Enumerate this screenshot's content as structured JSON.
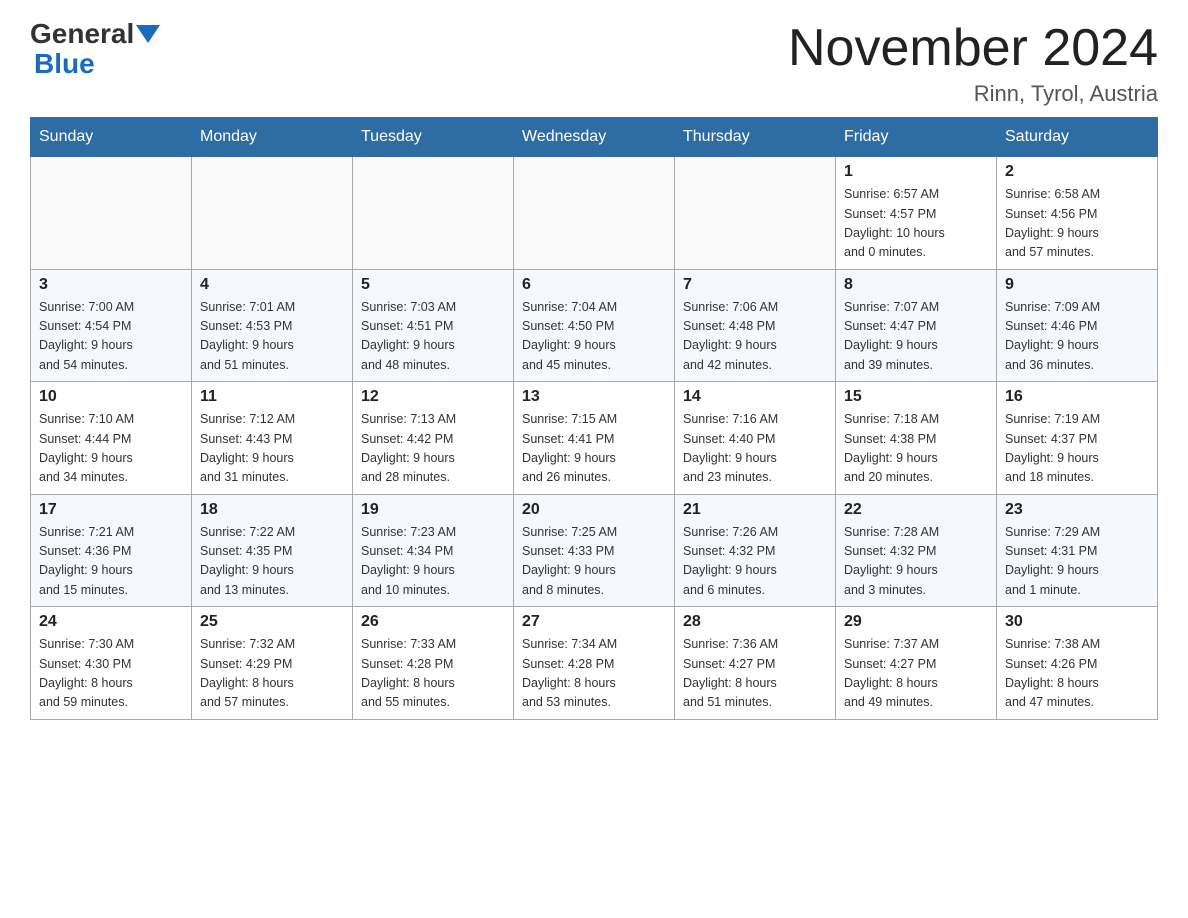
{
  "header": {
    "logo_line1": "General",
    "logo_line2": "Blue",
    "month_title": "November 2024",
    "location": "Rinn, Tyrol, Austria"
  },
  "weekdays": [
    "Sunday",
    "Monday",
    "Tuesday",
    "Wednesday",
    "Thursday",
    "Friday",
    "Saturday"
  ],
  "rows": [
    {
      "days": [
        {
          "number": "",
          "info": ""
        },
        {
          "number": "",
          "info": ""
        },
        {
          "number": "",
          "info": ""
        },
        {
          "number": "",
          "info": ""
        },
        {
          "number": "",
          "info": ""
        },
        {
          "number": "1",
          "info": "Sunrise: 6:57 AM\nSunset: 4:57 PM\nDaylight: 10 hours\nand 0 minutes."
        },
        {
          "number": "2",
          "info": "Sunrise: 6:58 AM\nSunset: 4:56 PM\nDaylight: 9 hours\nand 57 minutes."
        }
      ]
    },
    {
      "days": [
        {
          "number": "3",
          "info": "Sunrise: 7:00 AM\nSunset: 4:54 PM\nDaylight: 9 hours\nand 54 minutes."
        },
        {
          "number": "4",
          "info": "Sunrise: 7:01 AM\nSunset: 4:53 PM\nDaylight: 9 hours\nand 51 minutes."
        },
        {
          "number": "5",
          "info": "Sunrise: 7:03 AM\nSunset: 4:51 PM\nDaylight: 9 hours\nand 48 minutes."
        },
        {
          "number": "6",
          "info": "Sunrise: 7:04 AM\nSunset: 4:50 PM\nDaylight: 9 hours\nand 45 minutes."
        },
        {
          "number": "7",
          "info": "Sunrise: 7:06 AM\nSunset: 4:48 PM\nDaylight: 9 hours\nand 42 minutes."
        },
        {
          "number": "8",
          "info": "Sunrise: 7:07 AM\nSunset: 4:47 PM\nDaylight: 9 hours\nand 39 minutes."
        },
        {
          "number": "9",
          "info": "Sunrise: 7:09 AM\nSunset: 4:46 PM\nDaylight: 9 hours\nand 36 minutes."
        }
      ]
    },
    {
      "days": [
        {
          "number": "10",
          "info": "Sunrise: 7:10 AM\nSunset: 4:44 PM\nDaylight: 9 hours\nand 34 minutes."
        },
        {
          "number": "11",
          "info": "Sunrise: 7:12 AM\nSunset: 4:43 PM\nDaylight: 9 hours\nand 31 minutes."
        },
        {
          "number": "12",
          "info": "Sunrise: 7:13 AM\nSunset: 4:42 PM\nDaylight: 9 hours\nand 28 minutes."
        },
        {
          "number": "13",
          "info": "Sunrise: 7:15 AM\nSunset: 4:41 PM\nDaylight: 9 hours\nand 26 minutes."
        },
        {
          "number": "14",
          "info": "Sunrise: 7:16 AM\nSunset: 4:40 PM\nDaylight: 9 hours\nand 23 minutes."
        },
        {
          "number": "15",
          "info": "Sunrise: 7:18 AM\nSunset: 4:38 PM\nDaylight: 9 hours\nand 20 minutes."
        },
        {
          "number": "16",
          "info": "Sunrise: 7:19 AM\nSunset: 4:37 PM\nDaylight: 9 hours\nand 18 minutes."
        }
      ]
    },
    {
      "days": [
        {
          "number": "17",
          "info": "Sunrise: 7:21 AM\nSunset: 4:36 PM\nDaylight: 9 hours\nand 15 minutes."
        },
        {
          "number": "18",
          "info": "Sunrise: 7:22 AM\nSunset: 4:35 PM\nDaylight: 9 hours\nand 13 minutes."
        },
        {
          "number": "19",
          "info": "Sunrise: 7:23 AM\nSunset: 4:34 PM\nDaylight: 9 hours\nand 10 minutes."
        },
        {
          "number": "20",
          "info": "Sunrise: 7:25 AM\nSunset: 4:33 PM\nDaylight: 9 hours\nand 8 minutes."
        },
        {
          "number": "21",
          "info": "Sunrise: 7:26 AM\nSunset: 4:32 PM\nDaylight: 9 hours\nand 6 minutes."
        },
        {
          "number": "22",
          "info": "Sunrise: 7:28 AM\nSunset: 4:32 PM\nDaylight: 9 hours\nand 3 minutes."
        },
        {
          "number": "23",
          "info": "Sunrise: 7:29 AM\nSunset: 4:31 PM\nDaylight: 9 hours\nand 1 minute."
        }
      ]
    },
    {
      "days": [
        {
          "number": "24",
          "info": "Sunrise: 7:30 AM\nSunset: 4:30 PM\nDaylight: 8 hours\nand 59 minutes."
        },
        {
          "number": "25",
          "info": "Sunrise: 7:32 AM\nSunset: 4:29 PM\nDaylight: 8 hours\nand 57 minutes."
        },
        {
          "number": "26",
          "info": "Sunrise: 7:33 AM\nSunset: 4:28 PM\nDaylight: 8 hours\nand 55 minutes."
        },
        {
          "number": "27",
          "info": "Sunrise: 7:34 AM\nSunset: 4:28 PM\nDaylight: 8 hours\nand 53 minutes."
        },
        {
          "number": "28",
          "info": "Sunrise: 7:36 AM\nSunset: 4:27 PM\nDaylight: 8 hours\nand 51 minutes."
        },
        {
          "number": "29",
          "info": "Sunrise: 7:37 AM\nSunset: 4:27 PM\nDaylight: 8 hours\nand 49 minutes."
        },
        {
          "number": "30",
          "info": "Sunrise: 7:38 AM\nSunset: 4:26 PM\nDaylight: 8 hours\nand 47 minutes."
        }
      ]
    }
  ]
}
